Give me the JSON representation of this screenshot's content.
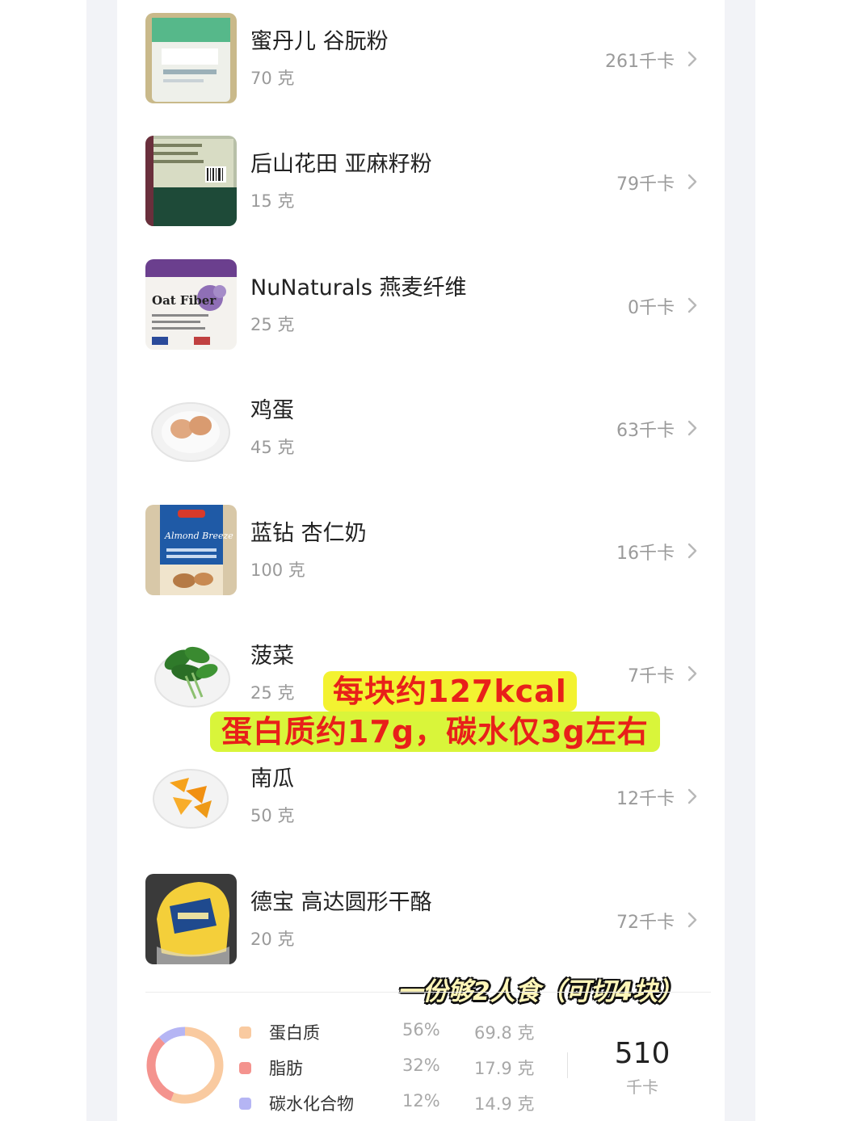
{
  "foods": [
    {
      "name": "蜜丹儿 谷朊粉",
      "amount": "70 克",
      "kcal": "261千卡",
      "image": "gluten-flour-bag"
    },
    {
      "name": "后山花田 亚麻籽粉",
      "amount": "15 克",
      "kcal": "79千卡",
      "image": "flaxseed-bag"
    },
    {
      "name": "NuNaturals 燕麦纤维",
      "amount": "25 克",
      "kcal": "0千卡",
      "image": "oat-fiber-bag",
      "image_text": "Oat Fiber"
    },
    {
      "name": "鸡蛋",
      "amount": "45 克",
      "kcal": "63千卡",
      "image": "eggs-plate"
    },
    {
      "name": "蓝钻 杏仁奶",
      "amount": "100 克",
      "kcal": "16千卡",
      "image": "almond-milk-carton",
      "image_text": "Almond Breeze"
    },
    {
      "name": "菠菜",
      "amount": "25 克",
      "kcal": "7千卡",
      "image": "spinach-plate"
    },
    {
      "name": "南瓜",
      "amount": "50 克",
      "kcal": "12千卡",
      "image": "pumpkin-plate"
    },
    {
      "name": "德宝 高达圆形干酪",
      "amount": "20 克",
      "kcal": "72千卡",
      "image": "gouda-cheese"
    }
  ],
  "overlays": {
    "line1": "每块约127kcal",
    "line2": "蛋白质约17g，碳水仅3g左右",
    "line3": "一份够2人食（可切4块）"
  },
  "summary": {
    "macros": [
      {
        "name": "蛋白质",
        "percent": "56%",
        "grams": "69.8 克",
        "color": "#f9caa0",
        "share": 0.56
      },
      {
        "name": "脂肪",
        "percent": "32%",
        "grams": "17.9 克",
        "color": "#f4938e",
        "share": 0.32
      },
      {
        "name": "碳水化合物",
        "percent": "12%",
        "grams": "14.9 克",
        "color": "#b5b5f4",
        "share": 0.12
      }
    ],
    "total_kcal": "510",
    "total_unit": "千卡"
  }
}
